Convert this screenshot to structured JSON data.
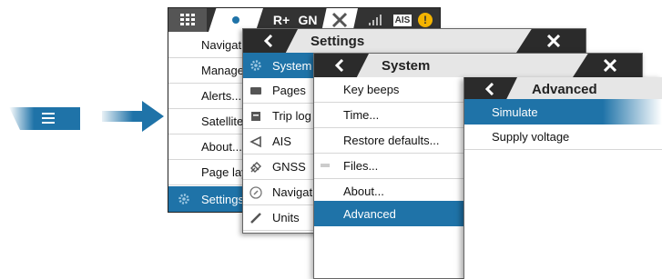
{
  "colors": {
    "accent": "#1f73a8",
    "dark_bar": "#333333",
    "title_bar": "#e6e6e6"
  },
  "toolbar": {
    "grid_icon": "grid-icon",
    "dot_icon": "status-dot-icon",
    "route_label": "R+",
    "gn_label": "GN",
    "signal_icon": "signal-icon",
    "ais_label": "AIS",
    "alert_label": "!",
    "menu_icon": "menu-icon"
  },
  "main_menu": {
    "items": [
      {
        "label": "Navigatio",
        "icon": ""
      },
      {
        "label": "Manage w",
        "icon": ""
      },
      {
        "label": "Alerts...",
        "icon": ""
      },
      {
        "label": "Satellites",
        "icon": ""
      },
      {
        "label": "About...",
        "icon": ""
      },
      {
        "label": "Page layo",
        "icon": ""
      },
      {
        "label": "Settings",
        "icon": "gear-icon"
      }
    ]
  },
  "settings": {
    "title": "Settings",
    "items": [
      {
        "label": "System",
        "icon": "gear-icon"
      },
      {
        "label": "Pages",
        "icon": "pages-icon"
      },
      {
        "label": "Trip log",
        "icon": "trip-log-icon"
      },
      {
        "label": "AIS",
        "icon": "ais-icon"
      },
      {
        "label": "GNSS",
        "icon": "gnss-icon"
      },
      {
        "label": "Navigatio",
        "icon": "navigation-icon"
      },
      {
        "label": "Units",
        "icon": "units-icon"
      }
    ]
  },
  "system": {
    "title": "System",
    "items": [
      {
        "label": "Key beeps"
      },
      {
        "label": "Time..."
      },
      {
        "label": "Restore defaults..."
      },
      {
        "label": "Files..."
      },
      {
        "label": "About..."
      },
      {
        "label": "Advanced"
      }
    ]
  },
  "advanced": {
    "title": "Advanced",
    "items": [
      {
        "label": "Simulate"
      },
      {
        "label": "Supply voltage"
      }
    ]
  }
}
